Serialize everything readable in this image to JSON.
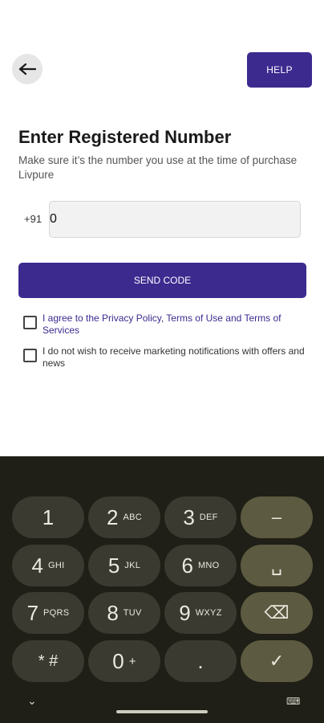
{
  "header": {
    "back_icon": "arrow-left-icon",
    "help_label": "HELP"
  },
  "main": {
    "title": "Enter Registered Number",
    "subtitle": "Make sure it’s the number you use at the time of purchase Livpure",
    "country_code": "+91",
    "phone_value": "0",
    "send_label": "SEND CODE",
    "agree_text": "I agree to the Privacy Policy, Terms of Use and Terms of Services",
    "marketing_text": "I do not wish to receive marketing notifications with offers and news"
  },
  "keyboard": {
    "keys": [
      {
        "main": "1",
        "sub": ""
      },
      {
        "main": "2",
        "sub": "ABC"
      },
      {
        "main": "3",
        "sub": "DEF"
      },
      {
        "main": "–",
        "sub": ""
      },
      {
        "main": "4",
        "sub": "GHI"
      },
      {
        "main": "5",
        "sub": "JKL"
      },
      {
        "main": "6",
        "sub": "MNO"
      },
      {
        "main": "␣",
        "sub": ""
      },
      {
        "main": "7",
        "sub": "PQRS"
      },
      {
        "main": "8",
        "sub": "TUV"
      },
      {
        "main": "9",
        "sub": "WXYZ"
      },
      {
        "main": "⌫",
        "sub": ""
      },
      {
        "main": "* #",
        "sub": ""
      },
      {
        "main": "0",
        "sub": "+"
      },
      {
        "main": ".",
        "sub": ""
      },
      {
        "main": "✓",
        "sub": ""
      }
    ],
    "chevron": "⌄",
    "keyboard_icon": "⌨"
  },
  "colors": {
    "brand": "#3d2a8f",
    "keyboard_bg": "#1f1f17"
  }
}
